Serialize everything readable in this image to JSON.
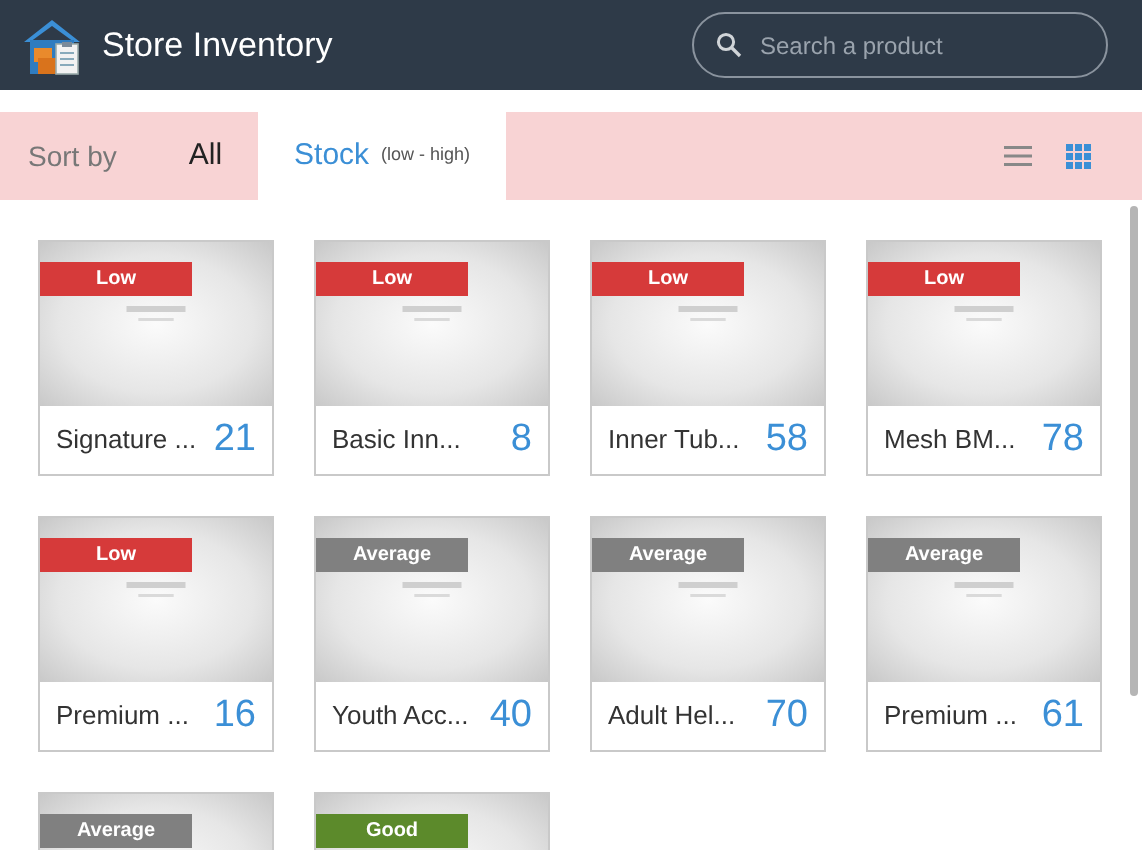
{
  "header": {
    "title": "Store Inventory",
    "search": {
      "placeholder": "Search a product"
    }
  },
  "sort_bar": {
    "label": "Sort by",
    "options": [
      {
        "label": "All",
        "selected": false
      },
      {
        "label": "Stock",
        "note": "(low - high)",
        "selected": true
      }
    ],
    "views": [
      {
        "kind": "list",
        "selected": false
      },
      {
        "kind": "grid",
        "selected": true
      }
    ]
  },
  "products": [
    {
      "name": "Signature ...",
      "count": "21",
      "badge": {
        "label": "Low",
        "color": "#d63a3a"
      }
    },
    {
      "name": "Basic Inn...",
      "count": "8",
      "badge": {
        "label": "Low",
        "color": "#d63a3a"
      }
    },
    {
      "name": "Inner Tub...",
      "count": "58",
      "badge": {
        "label": "Low",
        "color": "#d63a3a"
      }
    },
    {
      "name": "Mesh BM...",
      "count": "78",
      "badge": {
        "label": "Low",
        "color": "#d63a3a"
      }
    },
    {
      "name": "Premium ...",
      "count": "16",
      "badge": {
        "label": "Low",
        "color": "#d63a3a"
      }
    },
    {
      "name": "Youth Acc...",
      "count": "40",
      "badge": {
        "label": "Average",
        "color": "#808080"
      }
    },
    {
      "name": "Adult Hel...",
      "count": "70",
      "badge": {
        "label": "Average",
        "color": "#808080"
      }
    },
    {
      "name": "Premium ...",
      "count": "61",
      "badge": {
        "label": "Average",
        "color": "#808080"
      }
    },
    {
      "badge": {
        "label": "Average",
        "color": "#808080"
      }
    },
    {
      "badge": {
        "label": "Good",
        "color": "#5c8a2b"
      }
    }
  ]
}
